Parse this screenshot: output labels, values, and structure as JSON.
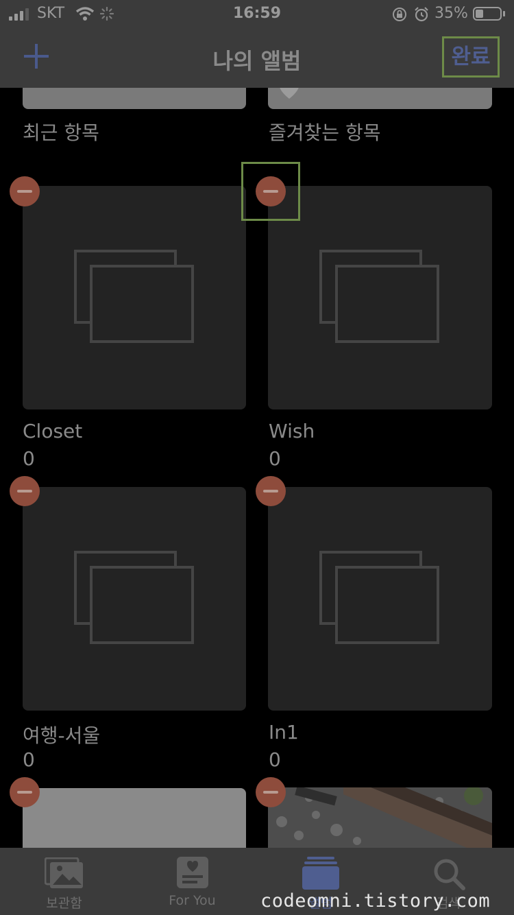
{
  "status_bar": {
    "carrier": "SKT",
    "time": "16:59",
    "battery_percent": "35%",
    "icons": [
      "signal-icon",
      "wifi-icon",
      "activity-icon",
      "orientation-lock-icon",
      "alarm-icon",
      "battery-icon"
    ]
  },
  "nav": {
    "title": "나의 앨범",
    "done_label": "완료",
    "accent": "#4f5e90"
  },
  "top_albums": [
    {
      "name": "최근 항목"
    },
    {
      "name": "즐겨찾는 항목"
    }
  ],
  "albums": [
    {
      "name": "Closet",
      "count": "0"
    },
    {
      "name": "Wish",
      "count": "0"
    },
    {
      "name": "여행-서울",
      "count": "0"
    },
    {
      "name": "In1",
      "count": "0"
    }
  ],
  "tabs": [
    {
      "label": "보관함",
      "icon": "photos-icon"
    },
    {
      "label": "For You",
      "icon": "for-you-icon"
    },
    {
      "label": "앨범",
      "icon": "albums-icon",
      "active": true
    },
    {
      "label": "검색",
      "icon": "search-icon"
    }
  ],
  "watermark": "codeomni.tistory.com",
  "colors": {
    "delete": "#8e4c3c",
    "highlight": "#6d8b48",
    "background": "#000000"
  }
}
